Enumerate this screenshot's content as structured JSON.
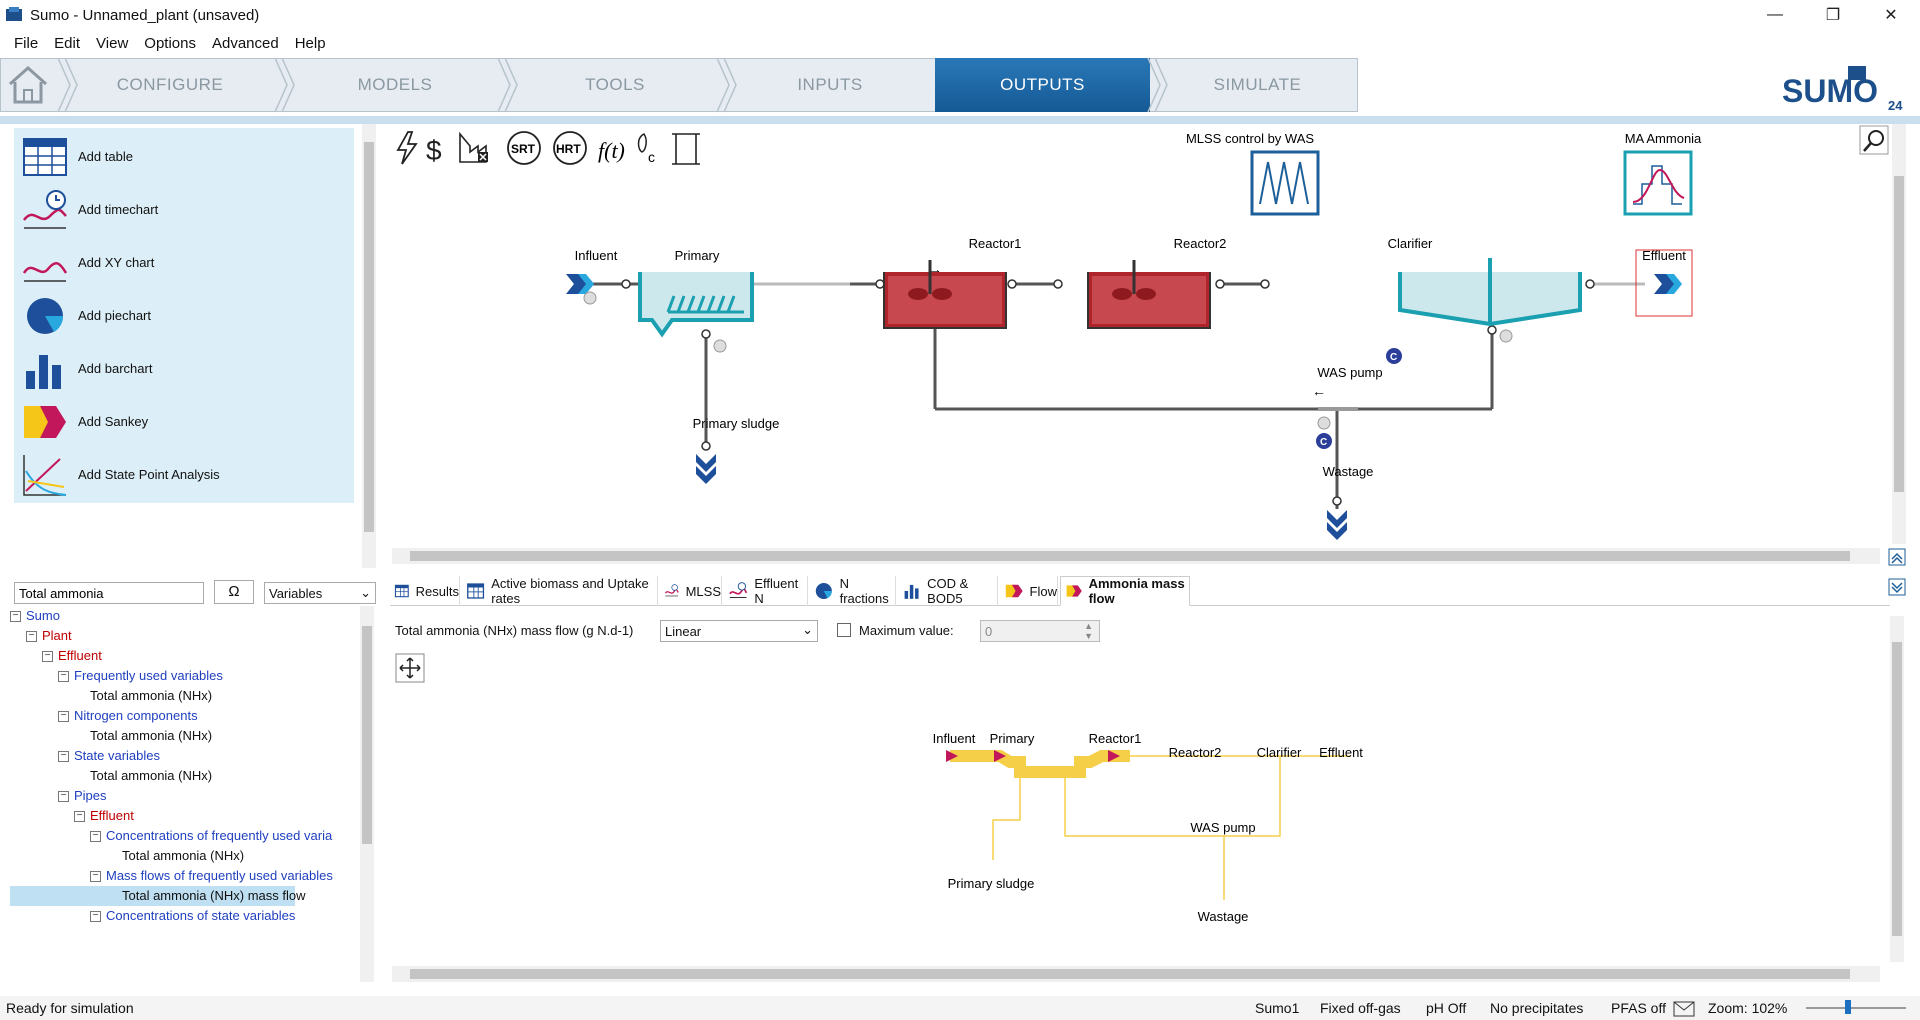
{
  "window": {
    "title": "Sumo - Unnamed_plant (unsaved)",
    "minimize": "—",
    "restore": "❐",
    "close": "✕"
  },
  "menu": [
    "File",
    "Edit",
    "View",
    "Options",
    "Advanced",
    "Help"
  ],
  "nav": {
    "tabs": [
      "CONFIGURE",
      "MODELS",
      "TOOLS",
      "INPUTS",
      "OUTPUTS",
      "SIMULATE"
    ],
    "active": "OUTPUTS",
    "logo_text": "SUMO",
    "logo_version": "24"
  },
  "tools": [
    "Add table",
    "Add timechart",
    "Add XY chart",
    "Add piechart",
    "Add barchart",
    "Add Sankey",
    "Add State Point Analysis"
  ],
  "canvas": {
    "toolbar_icons": [
      "lightning-icon",
      "dollar-icon",
      "gas-icon",
      "srt-icon",
      "hrt-icon",
      "function-icon",
      "footprint-icon",
      "scroll-icon"
    ],
    "srt_label": "SRT",
    "hrt_label": "HRT",
    "func_label": "f(t)",
    "controllers": [
      {
        "label": "MLSS control by WAS"
      },
      {
        "label": "MA Ammonia"
      }
    ],
    "units": {
      "influent": "Influent",
      "primary": "Primary",
      "reactor1": "Reactor1",
      "reactor2": "Reactor2",
      "clarifier": "Clarifier",
      "effluent": "Effluent",
      "was_pump": "WAS pump",
      "primary_sludge": "Primary sludge",
      "wastage": "Wastage"
    },
    "c_badge": "C"
  },
  "search": {
    "value": "Total ammonia",
    "omega": "Ω",
    "filter": "Variables"
  },
  "tree": [
    {
      "label": "Sumo",
      "level": 0,
      "color": "blue",
      "box": "−"
    },
    {
      "label": "Plant",
      "level": 1,
      "color": "red",
      "box": "−"
    },
    {
      "label": "Effluent",
      "level": 2,
      "color": "red",
      "box": "−"
    },
    {
      "label": "Frequently used variables",
      "level": 3,
      "color": "blue",
      "box": "−"
    },
    {
      "label": "Total ammonia (NHx)",
      "level": 4,
      "color": "blk",
      "box": ""
    },
    {
      "label": "Nitrogen components",
      "level": 3,
      "color": "blue",
      "box": "−"
    },
    {
      "label": "Total ammonia (NHx)",
      "level": 4,
      "color": "blk",
      "box": ""
    },
    {
      "label": "State variables",
      "level": 3,
      "color": "blue",
      "box": "−"
    },
    {
      "label": "Total ammonia (NHx)",
      "level": 4,
      "color": "blk",
      "box": ""
    },
    {
      "label": "Pipes",
      "level": 3,
      "color": "blue",
      "box": "−"
    },
    {
      "label": "Effluent",
      "level": 4,
      "color": "red",
      "box": "−"
    },
    {
      "label": "Concentrations of frequently used varia",
      "level": 5,
      "color": "blue",
      "box": "−"
    },
    {
      "label": "Total ammonia (NHx)",
      "level": 6,
      "color": "blk",
      "box": ""
    },
    {
      "label": "Mass flows of frequently used variables",
      "level": 5,
      "color": "blue",
      "box": "−"
    },
    {
      "label": "Total ammonia (NHx) mass flow",
      "level": 6,
      "color": "blk",
      "box": "",
      "selected": true
    },
    {
      "label": "Concentrations of state variables",
      "level": 5,
      "color": "blue",
      "box": "−"
    }
  ],
  "tabs": [
    {
      "label": "Results",
      "icon": "table-icon"
    },
    {
      "label": "Active biomass and Uptake rates",
      "icon": "table-icon"
    },
    {
      "label": "MLSS",
      "icon": "timechart-icon"
    },
    {
      "label": "Effluent N",
      "icon": "timechart-icon"
    },
    {
      "label": "N fractions",
      "icon": "piechart-icon"
    },
    {
      "label": "COD & BOD5",
      "icon": "barchart-icon"
    },
    {
      "label": "Flow",
      "icon": "sankey-icon"
    },
    {
      "label": "Ammonia mass flow",
      "icon": "sankey-icon",
      "selected": true
    }
  ],
  "sankey_panel": {
    "variable_label": "Total ammonia (NHx) mass flow (g N.d-1)",
    "scale": "Linear",
    "max_label": "Maximum value:",
    "max_value": "0",
    "nodes": {
      "influent": "Influent",
      "primary": "Primary",
      "reactor1": "Reactor1",
      "reactor2": "Reactor2",
      "clarifier": "Clarifier",
      "effluent": "Effluent",
      "was_pump": "WAS pump",
      "primary_sludge": "Primary sludge",
      "wastage": "Wastage"
    },
    "colors": {
      "flow": "#f5cf48",
      "marker": "#c2185b"
    }
  },
  "status": {
    "message": "Ready for simulation",
    "model": "Sumo1",
    "offgas": "Fixed off-gas",
    "ph": "pH Off",
    "precip": "No precipitates",
    "pfas": "PFAS off",
    "zoom": "Zoom: 102%"
  }
}
